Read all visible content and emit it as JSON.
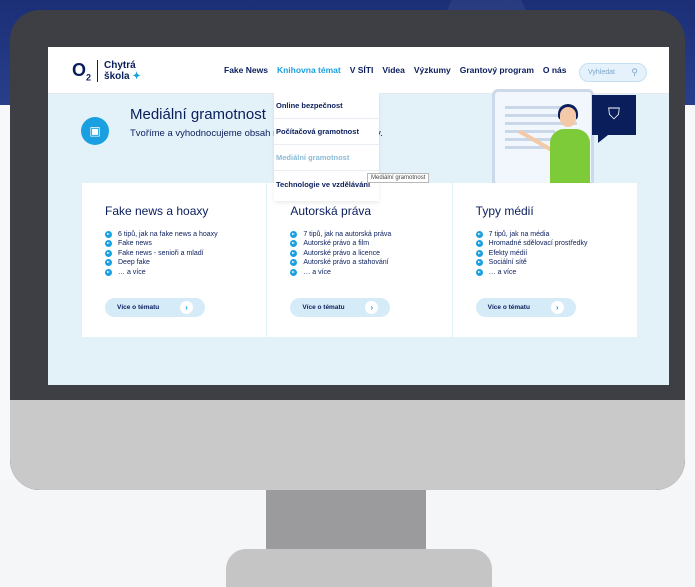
{
  "nav": {
    "logo_o2": "O",
    "logo_sub": "2",
    "logo_text_1": "Chytrá",
    "logo_text_2": "škola",
    "items": [
      "Fake News",
      "Knihovna témat",
      "V SÍTI",
      "Videa",
      "Výzkumy",
      "Grantový program",
      "O nás"
    ],
    "active_index": 1,
    "search_placeholder": "Vyhledat"
  },
  "dropdown": {
    "items": [
      "Online bezpečnost",
      "Počítačová gramotnost",
      "Mediální gramotnost",
      "Technologie ve vzdělávání"
    ],
    "active_index": 2,
    "tooltip": "Mediální gramotnost"
  },
  "hero": {
    "title": "Mediální gramotnost",
    "text": "Tvoříme a vyhodnocujeme obsah me                                 í s rozumem a kriticky."
  },
  "cards": [
    {
      "title": "Fake news a hoaxy",
      "items": [
        "6 tipů, jak na fake news a hoaxy",
        "Fake news",
        "Fake news - senioři a mladí",
        "Deep fake",
        "… a více"
      ],
      "button": "Více o tématu"
    },
    {
      "title": "Autorská práva",
      "items": [
        "7 tipů, jak na autorská práva",
        "Autorské právo a film",
        "Autorské právo a licence",
        "Autorské právo a stahování",
        "… a více"
      ],
      "button": "Více o tématu"
    },
    {
      "title": "Typy médií",
      "items": [
        "7 tipů, jak na média",
        "Hromadné sdělovací prostředky",
        "Efekty médií",
        "Sociální sítě",
        "… a více"
      ],
      "button": "Více o tématu"
    }
  ],
  "colors": {
    "brand_navy": "#0a1e5c",
    "accent_blue": "#1aa0e0",
    "screen_bg": "#e3f1f9",
    "monitor_frame": "#3d3f44"
  }
}
